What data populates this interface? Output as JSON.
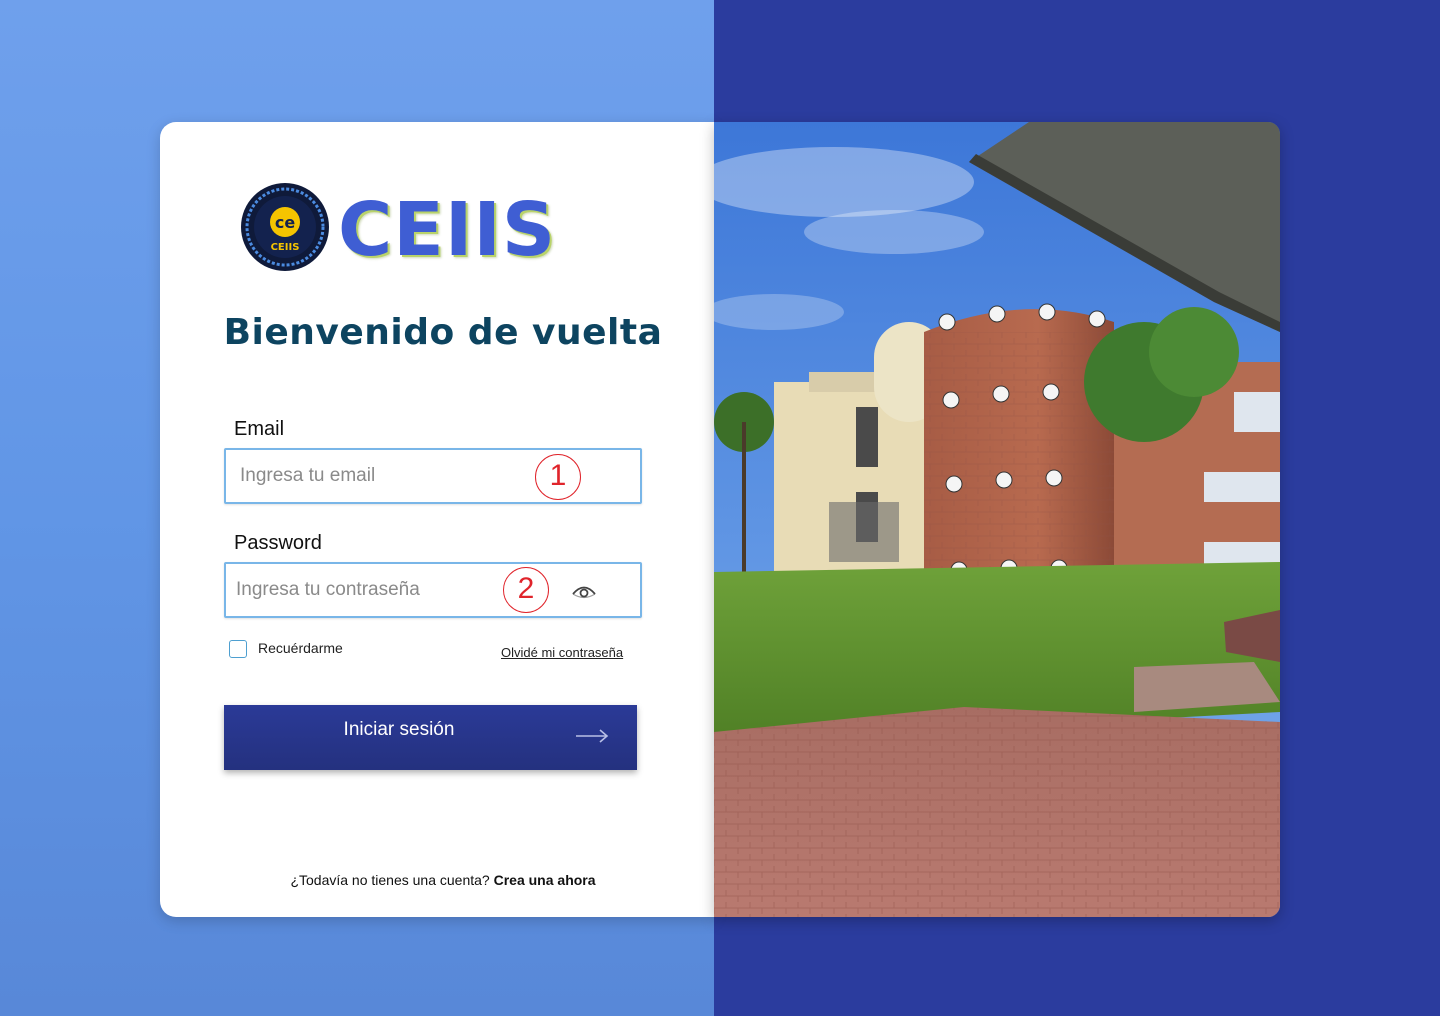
{
  "brand": {
    "name": "CEIIS",
    "badge_text": "CEIIS",
    "primary_color": "#2b3c9e",
    "heading_color": "#0d4460"
  },
  "heading": "Bienvenido de vuelta",
  "email": {
    "label": "Email",
    "placeholder": "Ingresa tu email",
    "marker": "1"
  },
  "password": {
    "label": "Password",
    "placeholder": "Ingresa tu contraseña",
    "marker": "2",
    "toggle_icon": "eye-icon"
  },
  "remember_label": "Recuérdarme",
  "forgot_label": "Olvidé mi contraseña",
  "submit": {
    "label": "Iniciar sesión",
    "icon": "arrow-right-icon"
  },
  "signup": {
    "prompt": "¿Todavía no tienes una cuenta?",
    "link": "Crea una ahora"
  }
}
